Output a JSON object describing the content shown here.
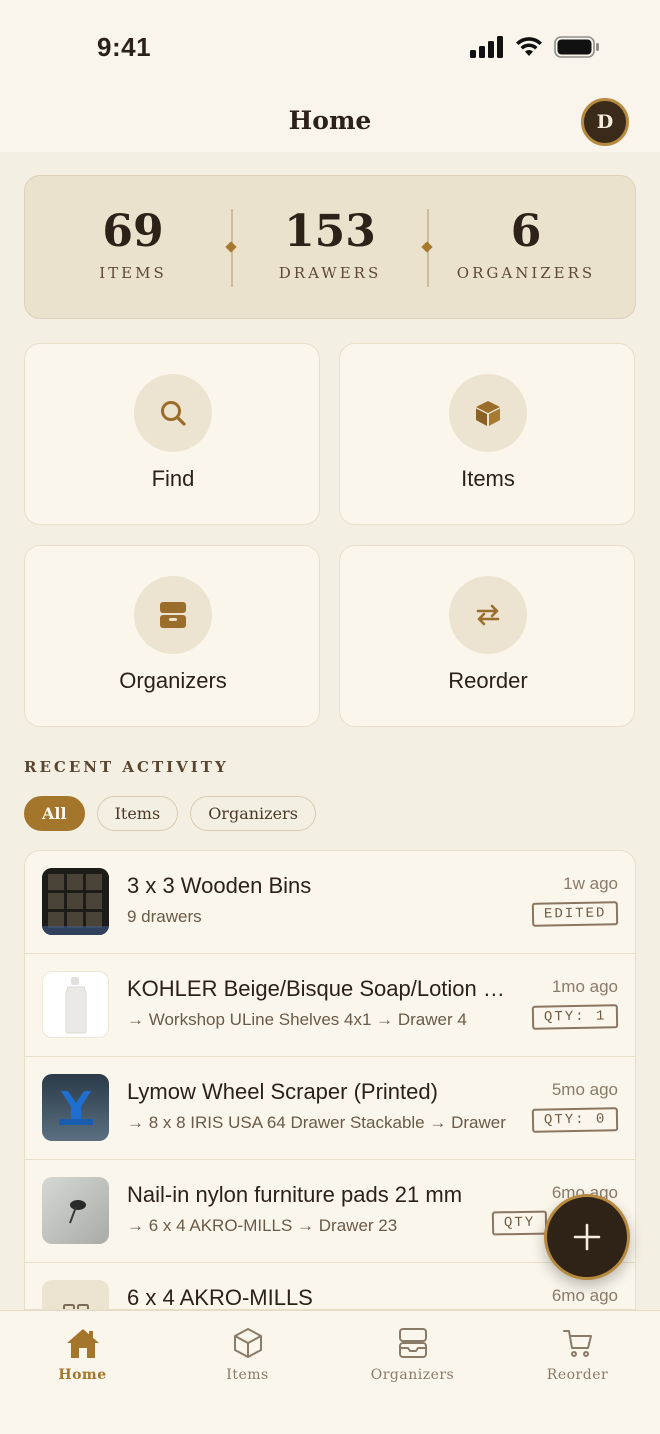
{
  "status_bar": {
    "time": "9:41"
  },
  "header": {
    "title": "Home",
    "avatar_initial": "D"
  },
  "stats": [
    {
      "value": "69",
      "label": "ITEMS"
    },
    {
      "value": "153",
      "label": "DRAWERS"
    },
    {
      "value": "6",
      "label": "ORGANIZERS"
    }
  ],
  "tiles": [
    {
      "label": "Find",
      "icon": "search-icon"
    },
    {
      "label": "Items",
      "icon": "box-icon"
    },
    {
      "label": "Organizers",
      "icon": "organizer-icon"
    },
    {
      "label": "Reorder",
      "icon": "reorder-icon"
    }
  ],
  "recent_activity": {
    "heading": "RECENT ACTIVITY",
    "filters": [
      "All",
      "Items",
      "Organizers"
    ],
    "active_filter": "All",
    "rows": [
      {
        "title": "3 x 3 Wooden Bins",
        "subtitle": "9 drawers",
        "time": "1w ago",
        "badge": "EDITED"
      },
      {
        "title": "KOHLER Beige/Bisque Soap/Lotion Dispenser",
        "subtitle": "→ Workshop ULine Shelves 4x1 → Drawer 4",
        "time": "1mo ago",
        "badge": "QTY: 1"
      },
      {
        "title": "Lymow Wheel Scraper (Printed)",
        "subtitle": "→ 8 x 8 IRIS USA 64 Drawer Stackable → Drawer",
        "time": "5mo ago",
        "badge": "QTY: 0"
      },
      {
        "title": "Nail-in nylon furniture pads 21 mm",
        "subtitle": "→ 6 x 4 AKRO-MILLS → Drawer 23",
        "time": "6mo ago",
        "badge": "QTY"
      },
      {
        "title": "6 x 4 AKRO-MILLS",
        "subtitle": "",
        "time": "6mo ago",
        "badge": ""
      }
    ]
  },
  "tab_bar": [
    {
      "label": "Home",
      "icon": "home-icon",
      "active": true
    },
    {
      "label": "Items",
      "icon": "cube-icon",
      "active": false
    },
    {
      "label": "Organizers",
      "icon": "organizer-icon",
      "active": false
    },
    {
      "label": "Reorder",
      "icon": "cart-icon",
      "active": false
    }
  ],
  "colors": {
    "accent": "#a4762b",
    "dark": "#2f2216",
    "background": "#f4efe3",
    "card": "#faf6ec"
  }
}
